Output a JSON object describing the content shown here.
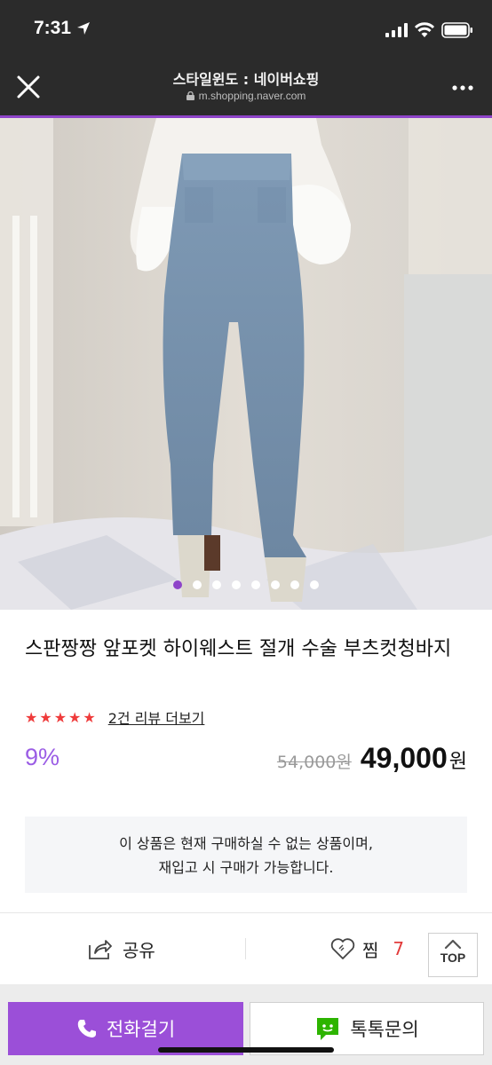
{
  "status_bar": {
    "time": "7:31",
    "icons": [
      "location-arrow-icon",
      "cellular-signal-icon",
      "wifi-icon",
      "battery-icon"
    ]
  },
  "browser": {
    "title": "스타일윈도 : 네이버쇼핑",
    "url": "m.shopping.naver.com",
    "icons": [
      "close-icon",
      "lock-icon",
      "more-dots-icon"
    ]
  },
  "gallery": {
    "image_count": 8,
    "active_index": 0
  },
  "product": {
    "name": "스판짱짱 앞포켓 하이웨스트 절개 수술 부츠컷청바지",
    "rating_stars": 5,
    "stars": "★★★★★",
    "review_link": "2건 리뷰 더보기",
    "discount_rate": "9%",
    "original_price": "54,000원",
    "sale_price": "49,000",
    "currency": "원"
  },
  "notice": {
    "line1": "이 상품은 현재 구매하실 수 없는 상품이며,",
    "line2": "재입고 시 구매가 가능합니다."
  },
  "actions": {
    "share_label": "공유",
    "wish_label": "찜",
    "wish_count": "7",
    "top_label": "TOP"
  },
  "bottom_bar": {
    "call_label": "전화걸기",
    "talk_label": "톡톡문의"
  },
  "colors": {
    "accent": "#9b4fd8",
    "discount": "#9b5de5",
    "stars": "#ef3b3b",
    "wish_count": "#e23b3b",
    "header_bg": "#2b2b2b"
  }
}
